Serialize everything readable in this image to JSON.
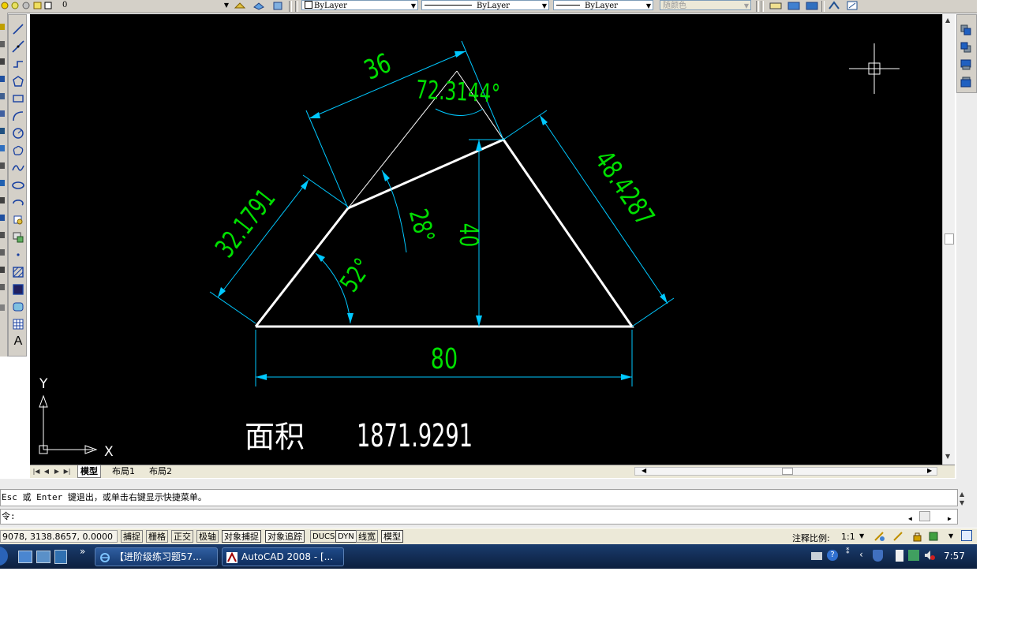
{
  "toolbar": {
    "layer_value": "0",
    "color_value": "ByLayer",
    "linetype_value": "ByLayer",
    "lineweight_value": "ByLayer",
    "plotstyle_value": "随颜色"
  },
  "drawing": {
    "dim_base": "80",
    "dim_left": "32.1791",
    "dim_top": "36",
    "dim_right": "48.4287",
    "dim_height": "40",
    "angle_top": "72.3144°",
    "angle_mid": "28°",
    "angle_base": "52°",
    "area_label": "面积",
    "area_value": "1871.9291"
  },
  "ucs": {
    "x_label": "X",
    "y_label": "Y"
  },
  "tabs": [
    "模型",
    "布局1",
    "布局2"
  ],
  "command": {
    "history": "Esc 或 Enter 键退出，或单击右键显示快捷菜单。",
    "prompt": "令:"
  },
  "status": {
    "coordinates": "9078, 3138.8657, 0.0000",
    "toggles": [
      "捕捉",
      "栅格",
      "正交",
      "极轴",
      "对象捕捉",
      "对象追踪",
      "DUCS",
      "DYN",
      "线宽",
      "模型"
    ],
    "annotation_scale_label": "注释比例:",
    "annotation_scale_value": "1:1"
  },
  "taskbar": {
    "apps": [
      "【进阶级练习题57...",
      "AutoCAD 2008 - [..."
    ],
    "time": "7:57"
  },
  "colors": {
    "canvas": "#000000",
    "geometry": "#ffffff",
    "dimension_line": "#00c8ff",
    "dimension_text": "#00e000",
    "taskbar": "#1a3c6d"
  }
}
